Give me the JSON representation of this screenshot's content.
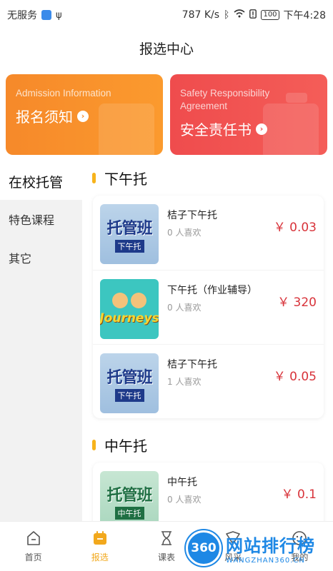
{
  "status_bar": {
    "carrier": "无服务",
    "network_speed": "787 K/s",
    "battery": "100",
    "time": "下午4:28"
  },
  "header": {
    "title": "报选中心"
  },
  "cards": [
    {
      "en": "Admission Information",
      "cn": "报名须知",
      "color": "#f6892a"
    },
    {
      "en": "Safety Responsibility Agreement",
      "cn": "安全责任书",
      "color": "#ef4c4d"
    }
  ],
  "sidebar": {
    "items": [
      {
        "label": "在校托管",
        "active": true
      },
      {
        "label": "特色课程",
        "active": false
      },
      {
        "label": "其它",
        "active": false
      }
    ]
  },
  "sections": [
    {
      "title": "下午托",
      "items": [
        {
          "title": "桔子下午托",
          "likes": "0 人喜欢",
          "price": "￥ 0.03",
          "thumb": "托管班 下午托"
        },
        {
          "title": "下午托（作业辅导）",
          "likes": "0 人喜欢",
          "price": "￥ 320",
          "thumb": "Journeys"
        },
        {
          "title": "桔子下午托",
          "likes": "1 人喜欢",
          "price": "￥ 0.05",
          "thumb": "托管班 下午托"
        }
      ]
    },
    {
      "title": "中午托",
      "items": [
        {
          "title": "中午托",
          "likes": "0 人喜欢",
          "price": "￥ 0.1",
          "thumb": "托管班 中午托"
        }
      ]
    }
  ],
  "tabbar": {
    "tabs": [
      {
        "label": "首页",
        "icon": "home-icon",
        "active": false
      },
      {
        "label": "报选",
        "icon": "enroll-icon",
        "active": true
      },
      {
        "label": "课表",
        "icon": "timetable-icon",
        "active": false
      },
      {
        "label": "风采",
        "icon": "gallery-icon",
        "active": false
      },
      {
        "label": "我的",
        "icon": "profile-icon",
        "active": false
      }
    ]
  },
  "watermark": {
    "logo": "360",
    "main": "网站排行榜",
    "sub": "WANGZHAN360.CN"
  },
  "colors": {
    "accent": "#f2a81c",
    "price": "#d8333a"
  }
}
